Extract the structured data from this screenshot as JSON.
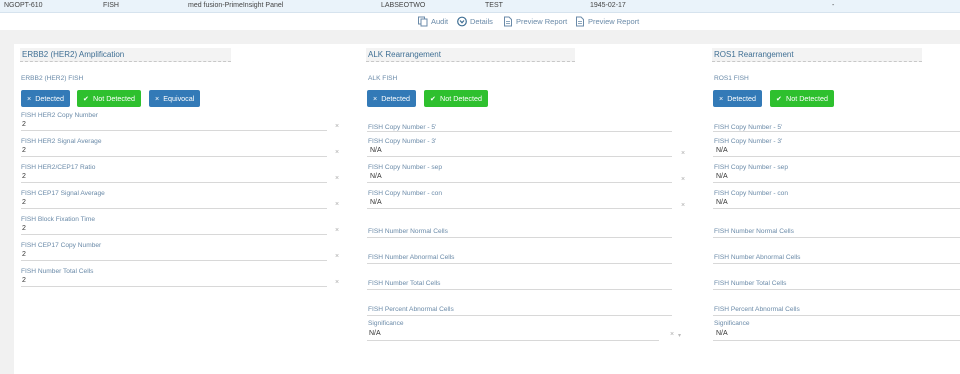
{
  "top_row": {
    "id": "NGOPT-610",
    "test_type": "FISH",
    "panel": "med fusion-PrimeInsight Panel",
    "lab": "LABSEOTWO",
    "name": "TEST",
    "dob": "1945-02-17",
    "dash": "-"
  },
  "toolbar": {
    "audit": "Audit",
    "details": "Details",
    "preview1": "Preview Report",
    "preview2": "Preview Report"
  },
  "buttons": {
    "detected": "Detected",
    "not_detected": "Not Detected",
    "equivocal": "Equivocal"
  },
  "col1": {
    "title": "ERBB2 (HER2) Amplification",
    "fish_label": "ERBB2 (HER2) FISH",
    "fields": [
      {
        "label": "FISH HER2 Copy Number",
        "value": "2"
      },
      {
        "label": "FISH HER2 Signal Average",
        "value": "2"
      },
      {
        "label": "FISH HER2/CEP17 Ratio",
        "value": "2"
      },
      {
        "label": "FISH CEP17 Signal Average",
        "value": "2"
      },
      {
        "label": "FISH Block Fixation Time",
        "value": "2"
      },
      {
        "label": "FISH CEP17 Copy Number",
        "value": "2"
      },
      {
        "label": "FISH Number Total Cells",
        "value": "2"
      }
    ]
  },
  "col2": {
    "title": "ALK Rearrangement",
    "fish_label": "ALK FISH",
    "fields": [
      {
        "label": "FISH Copy Number - 5'",
        "value": ""
      },
      {
        "label": "FISH Copy Number - 3'",
        "value": "N/A"
      },
      {
        "label": "FISH Copy Number - sep",
        "value": "N/A"
      },
      {
        "label": "FISH Copy Number - con",
        "value": "N/A"
      },
      {
        "label": "FISH Number Normal Cells",
        "value": ""
      },
      {
        "label": "FISH Number Abnormal Cells",
        "value": ""
      },
      {
        "label": "FISH Number Total Cells",
        "value": ""
      },
      {
        "label": "FISH Percent Abnormal Cells",
        "value": ""
      }
    ],
    "significance_label": "Significance",
    "significance_value": "N/A"
  },
  "col3": {
    "title": "ROS1 Rearrangement",
    "fish_label": "ROS1 FISH",
    "fields": [
      {
        "label": "FISH Copy Number - 5'",
        "value": ""
      },
      {
        "label": "FISH Copy Number - 3'",
        "value": "N/A"
      },
      {
        "label": "FISH Copy Number - sep",
        "value": "N/A"
      },
      {
        "label": "FISH Copy Number - con",
        "value": "N/A"
      },
      {
        "label": "FISH Number Normal Cells",
        "value": ""
      },
      {
        "label": "FISH Number Abnormal Cells",
        "value": ""
      },
      {
        "label": "FISH Number Total Cells",
        "value": ""
      },
      {
        "label": "FISH Percent Abnormal Cells",
        "value": ""
      }
    ],
    "significance_label": "Significance",
    "significance_value": "N/A"
  },
  "icons": {
    "clear": "×",
    "check": "✔",
    "caret": "▾"
  },
  "colors": {
    "detected": "#337ab7",
    "not_detected": "#2ec02e",
    "title": "#3f6f94"
  }
}
